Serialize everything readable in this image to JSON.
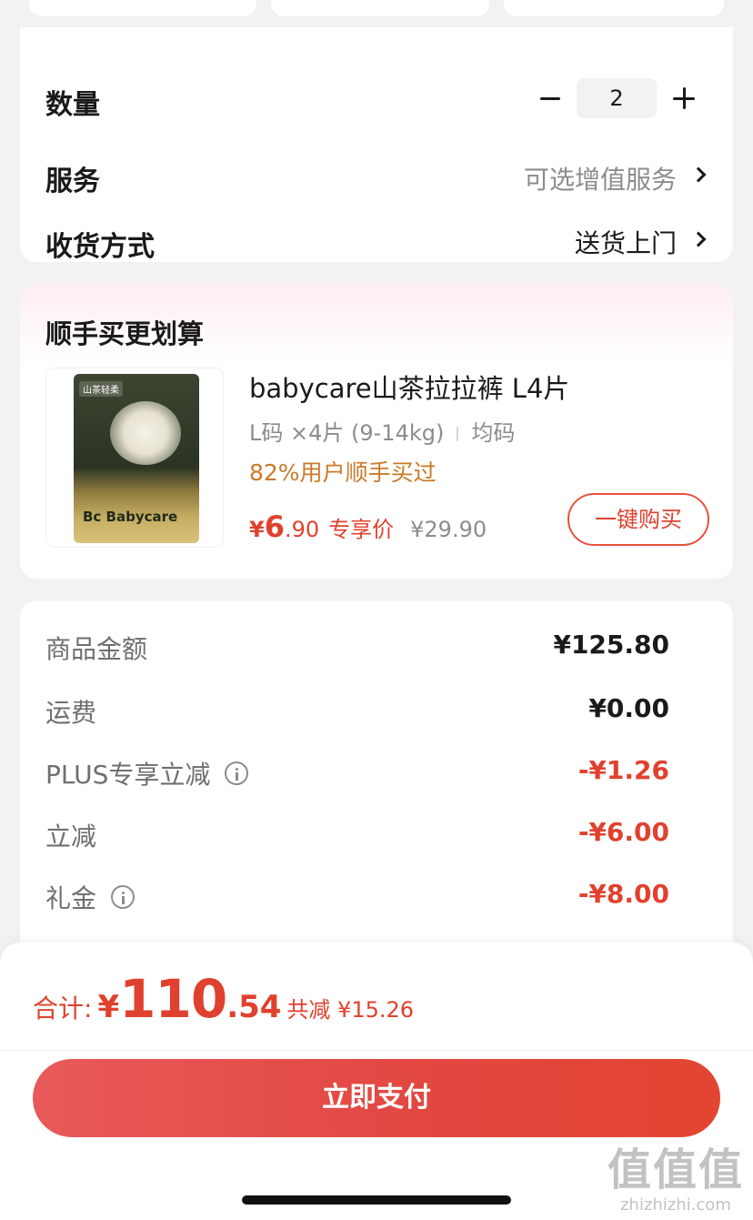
{
  "options": {
    "quantity_label": "数量",
    "quantity_value": "2",
    "service_label": "服务",
    "service_value": "可选增值服务",
    "shipping_label": "收货方式",
    "shipping_value": "送货上门"
  },
  "addon": {
    "title": "顺手买更划算",
    "product": {
      "name": "babycare山茶拉拉裤 L4片",
      "spec": "L码 ×4片 (9-14kg)",
      "size": "均码",
      "social_proof": "82%用户顺手买过",
      "price_symbol": "¥",
      "price_int": "6",
      "price_dec": ".90",
      "price_tag": "专享价",
      "original_price": "¥29.90",
      "image_tag": "山茶轻柔",
      "image_brand": "Bc Babycare",
      "buy_label": "一键购买"
    }
  },
  "summary": {
    "rows": [
      {
        "label": "商品金额",
        "value": "¥125.80"
      },
      {
        "label": "运费",
        "value": "¥0.00"
      },
      {
        "label": "PLUS专享立减",
        "value": "-¥1.26"
      },
      {
        "label": "立减",
        "value": "-¥6.00"
      },
      {
        "label": "礼金",
        "value": "-¥8.00"
      }
    ]
  },
  "checkout": {
    "total_label": "合计:",
    "total_symbol": "¥",
    "total_int": "110",
    "total_dec": ".54",
    "savings": "共减 ¥15.26",
    "pay_label": "立即支付"
  },
  "watermark": {
    "main": "值值值",
    "sub": "zhizhizhi.com"
  },
  "colors": {
    "accent": "#e0412e",
    "social": "#c97a28",
    "muted": "#8c8c8c"
  }
}
